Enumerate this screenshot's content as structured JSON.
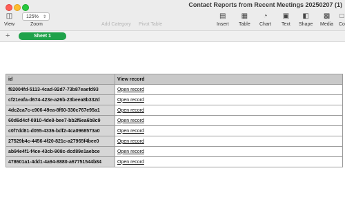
{
  "window": {
    "title": "Contact Reports from Recent Meetings 20250207 (1)"
  },
  "toolbar": {
    "view_label": "View",
    "zoom_value": "125%",
    "zoom_label": "Zoom",
    "add_category_label": "Add Category",
    "pivot_table_label": "Pivot Table",
    "insert_label": "Insert",
    "table_label": "Table",
    "chart_label": "Chart",
    "text_label": "Text",
    "shape_label": "Shape",
    "media_label": "Media",
    "comment_label": "Co"
  },
  "sheets": {
    "add_symbol": "+",
    "active": "Sheet 1"
  },
  "table": {
    "headers": [
      "id",
      "View record"
    ],
    "rows": [
      {
        "id": "f82004fd-5113-4cad-92d7-73b87eaefd93",
        "link": "Open record"
      },
      {
        "id": "cf21eafa-d674-423e-a26b-23beea8b332d",
        "link": "Open record"
      },
      {
        "id": "4dc2ca7c-c906-49ea-8f60-330c767e95a1",
        "link": "Open record"
      },
      {
        "id": "60d6d4cf-0910-4de8-bee7-bb2f6ea6b8c9",
        "link": "Open record"
      },
      {
        "id": "c0f7dd81-d055-4336-bdf2-4ca0968573a0",
        "link": "Open record"
      },
      {
        "id": "27529b4c-4456-4f20-821c-a27965f4bee0",
        "link": "Open record"
      },
      {
        "id": "ab94e4f1-f4ce-43cb-908c-dcd89e1aebce",
        "link": "Open record"
      },
      {
        "id": "478601a1-4dd1-4a94-8880-a67751544b84",
        "link": "Open record"
      }
    ]
  }
}
